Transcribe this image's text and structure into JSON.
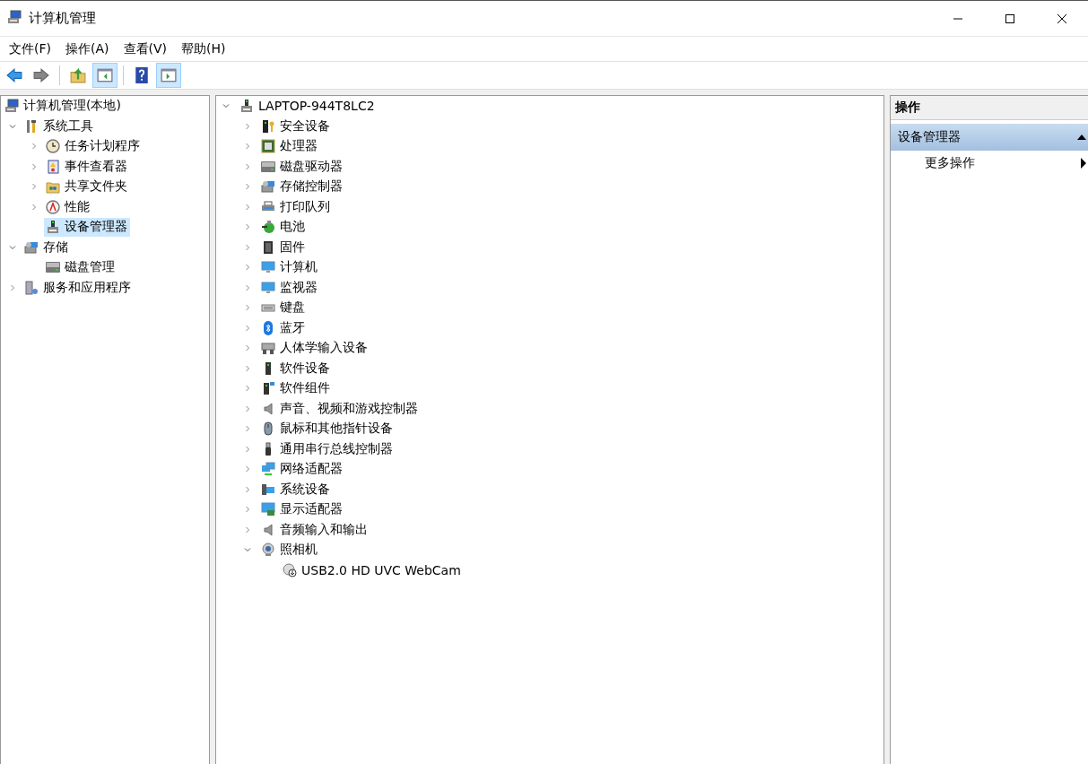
{
  "window": {
    "title": "计算机管理"
  },
  "menu": [
    {
      "label": "文件(F)"
    },
    {
      "label": "操作(A)"
    },
    {
      "label": "查看(V)"
    },
    {
      "label": "帮助(H)"
    }
  ],
  "toolbar": [
    {
      "on": false
    },
    {
      "on": false
    },
    {
      "on": false
    },
    {
      "on": true
    },
    {
      "on": false
    },
    {
      "on": true
    }
  ],
  "console_tree": {
    "label": "计算机管理(本地)",
    "selected": false,
    "children": [
      {
        "label": "系统工具",
        "selected": false,
        "expanded": true,
        "children": [
          {
            "label": "任务计划程序",
            "selected": false,
            "expanded": false
          },
          {
            "label": "事件查看器",
            "selected": false,
            "expanded": false
          },
          {
            "label": "共享文件夹",
            "selected": false,
            "expanded": false
          },
          {
            "label": "性能",
            "selected": false,
            "expanded": false
          },
          {
            "label": "设备管理器",
            "selected": true
          }
        ]
      },
      {
        "label": "存储",
        "selected": false,
        "expanded": true,
        "children": [
          {
            "label": "磁盘管理",
            "selected": false
          }
        ]
      },
      {
        "label": "服务和应用程序",
        "selected": false,
        "expanded": false
      }
    ]
  },
  "device_tree": {
    "label": "LAPTOP-944T8LC2",
    "expanded": true,
    "children": [
      {
        "label": "安全设备",
        "expanded": false
      },
      {
        "label": "处理器",
        "expanded": false
      },
      {
        "label": "磁盘驱动器",
        "expanded": false
      },
      {
        "label": "存储控制器",
        "expanded": false
      },
      {
        "label": "打印队列",
        "expanded": false
      },
      {
        "label": "电池",
        "expanded": false
      },
      {
        "label": "固件",
        "expanded": false
      },
      {
        "label": "计算机",
        "expanded": false
      },
      {
        "label": "监视器",
        "expanded": false
      },
      {
        "label": "键盘",
        "expanded": false
      },
      {
        "label": "蓝牙",
        "expanded": false
      },
      {
        "label": "人体学输入设备",
        "expanded": false
      },
      {
        "label": "软件设备",
        "expanded": false
      },
      {
        "label": "软件组件",
        "expanded": false
      },
      {
        "label": "声音、视频和游戏控制器",
        "expanded": false
      },
      {
        "label": "鼠标和其他指针设备",
        "expanded": false
      },
      {
        "label": "通用串行总线控制器",
        "expanded": false
      },
      {
        "label": "网络适配器",
        "expanded": false
      },
      {
        "label": "系统设备",
        "expanded": false
      },
      {
        "label": "显示适配器",
        "expanded": false
      },
      {
        "label": "音频输入和输出",
        "expanded": false
      },
      {
        "label": "照相机",
        "expanded": true,
        "children": [
          {
            "label": "USB2.0 HD UVC WebCam"
          }
        ]
      }
    ]
  },
  "actions": {
    "header": "操作",
    "section": {
      "label": "设备管理器",
      "expanded": true
    },
    "items": [
      {
        "label": "更多操作"
      }
    ]
  }
}
